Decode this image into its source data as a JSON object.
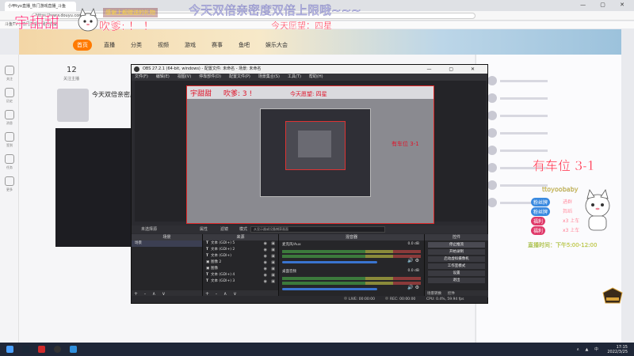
{
  "browser": {
    "tab_title": "小甲tyo直播_热门游戏直播_斗鱼",
    "window_controls": "— ▢ ✕",
    "address": "https://www.douyu.com/",
    "bookmarks": "斗鱼TV  |  热门游戏  |  我的收藏"
  },
  "site": {
    "nav_items": [
      {
        "label": "首页",
        "active": true
      },
      {
        "label": "直播",
        "active": false
      },
      {
        "label": "分类",
        "active": false
      },
      {
        "label": "视频",
        "active": false
      },
      {
        "label": "游戏",
        "active": false
      },
      {
        "label": "赛事",
        "active": false
      },
      {
        "label": "鱼吧",
        "active": false
      },
      {
        "label": "娱乐大会",
        "active": false
      }
    ],
    "rail_labels": [
      "关注",
      "历史",
      "消息",
      "签到",
      "任务",
      "更多"
    ],
    "stat_number": "12",
    "stat_label": "关注主播",
    "room_title": "今天双倍亲密度"
  },
  "obs": {
    "title": "OBS 27.2.1 (64-bit, windows) - 配置文件: 未命名 - 场景: 未命名",
    "window_controls": "— ▢ ✕",
    "menu": [
      "文件(F)",
      "编辑(E)",
      "视图(V)",
      "停靠部件(D)",
      "配置文件(P)",
      "场景集合(S)",
      "工具(T)",
      "帮助(H)"
    ],
    "preview": {
      "text_a": "宇甜甜",
      "text_b": "吹爹: 3 !",
      "text_c": "今天愿望: 四星",
      "text_d": "有车位 3-1"
    },
    "toolbar": {
      "no_source": "未选择源",
      "properties": "属性",
      "filters": "滤镜",
      "mode_label": "模式",
      "input_placeholder": "从显示器或设备捕获画面"
    },
    "docks": {
      "scenes_title": "场景",
      "scenes": [
        "场景"
      ],
      "sources_title": "来源",
      "sources": [
        {
          "icon": "T",
          "name": "文本 (GDI+) 5"
        },
        {
          "icon": "T",
          "name": "文本 (GDI+) 2"
        },
        {
          "icon": "T",
          "name": "文本 (GDI+)"
        },
        {
          "icon": "▣",
          "name": "图像 2"
        },
        {
          "icon": "▣",
          "name": "图像"
        },
        {
          "icon": "T",
          "name": "文本 (GDI+) 4"
        },
        {
          "icon": "T",
          "name": "文本 (GDI+) 3"
        }
      ],
      "mixer_title": "混音器",
      "mixer": [
        {
          "name": "麦克风/Aux",
          "db": "0.0 dB"
        },
        {
          "name": "桌面音频",
          "db": "0.0 dB"
        }
      ],
      "controls_title": "控件",
      "controls": [
        {
          "label": "停止推流",
          "active": true
        },
        {
          "label": "开始录制",
          "active": false
        },
        {
          "label": "启动虚拟摄像机",
          "active": false
        },
        {
          "label": "工作室模式",
          "active": false
        },
        {
          "label": "设置",
          "active": false
        },
        {
          "label": "退出",
          "active": false
        }
      ],
      "transition_tabs": [
        "场景转换",
        "控件"
      ],
      "foot_symbols": "+ - ∧ ∨"
    },
    "status": {
      "live_label": "LIVE:",
      "live_time": "00:00:00",
      "rec_label": "REC:",
      "rec_time": "00:00:00",
      "cpu": "CPU: 0.4%, 59.94 fps"
    }
  },
  "overlay": {
    "streamer_name": "宇甜甜",
    "banner": "感谢上舰赠送的礼物",
    "shout": "吹爹: ！ ！",
    "headline": "今天双倍亲密度双倍上限哦~~~",
    "wish": "今天愿望：四星",
    "car_slot": "有车位 3-1",
    "username": "ttoyoobaby",
    "activities": [
      {
        "tag": "粉丝牌",
        "action": "进群",
        "color": "#3a8ae0"
      },
      {
        "tag": "粉丝牌",
        "action": "舞蹈",
        "color": "#3a8ae0"
      },
      {
        "tag": "福利",
        "action": "x3 上车",
        "color": "#e03a6a"
      },
      {
        "tag": "福利",
        "action": "x3 上车",
        "color": "#e03a6a"
      }
    ],
    "schedule": "直播时间：下午5:00-12:00"
  },
  "taskbar": {
    "apps": [
      {
        "name": "windows-icon",
        "color": "#4aa0ff"
      },
      {
        "name": "steam-icon",
        "color": "#1b2838"
      },
      {
        "name": "game-launcher-icon",
        "color": "#d02a2a"
      },
      {
        "name": "obs-icon",
        "color": "#333333"
      },
      {
        "name": "edge-icon",
        "color": "#2f8fdc"
      }
    ],
    "time": "17:15",
    "date": "2022/3/25",
    "tray": "∧ ▲ 中"
  }
}
